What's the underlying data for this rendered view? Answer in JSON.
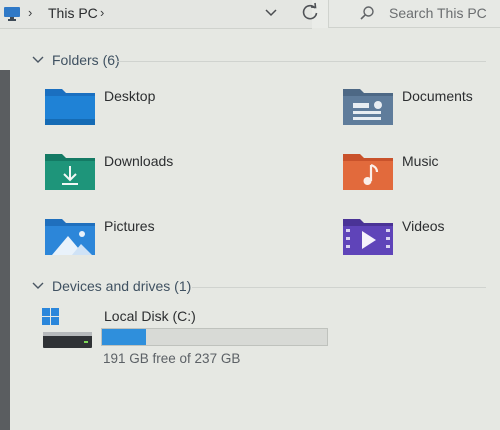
{
  "address_bar": {
    "location": "This PC",
    "icons": [
      "monitor-icon",
      "chevron-right-icon",
      "chevron-down-icon",
      "refresh-icon"
    ]
  },
  "search": {
    "placeholder": "Search This PC",
    "icon": "search-icon"
  },
  "folders_group": {
    "title": "Folders (6)",
    "items": [
      {
        "label": "Desktop",
        "icon": "desktop-folder-icon",
        "color": "#1f78c8"
      },
      {
        "label": "Documents",
        "icon": "documents-folder-icon",
        "color": "#55708e"
      },
      {
        "label": "Downloads",
        "icon": "downloads-folder-icon",
        "color": "#1f8a73"
      },
      {
        "label": "Music",
        "icon": "music-folder-icon",
        "color": "#e16436"
      },
      {
        "label": "Pictures",
        "icon": "pictures-folder-icon",
        "color": "#2c7fd1"
      },
      {
        "label": "Videos",
        "icon": "videos-folder-icon",
        "color": "#5f42b8"
      }
    ]
  },
  "drives_group": {
    "title": "Devices and drives (1)",
    "drives": [
      {
        "name": "Local Disk (C:)",
        "free_text": "191 GB free of 237 GB",
        "used_fraction": 0.194,
        "bar_color": "#2f8fdc",
        "icon": "windows-drive-icon"
      }
    ]
  }
}
